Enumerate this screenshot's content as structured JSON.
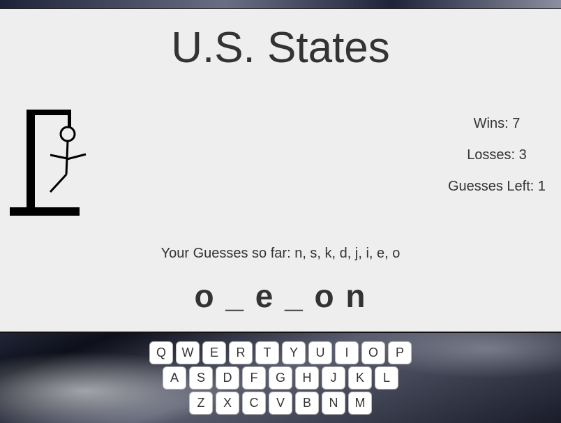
{
  "game": {
    "title": "U.S. States",
    "stats": {
      "wins": "Wins: 7",
      "losses": "Losses: 3",
      "guesses_left": "Guesses Left: 1"
    },
    "guesses_text": "Your Guesses so far: n, s, k, d, j, i, e, o",
    "word_display": "o _ e _ o n"
  },
  "keyboard": {
    "rows": [
      [
        "Q",
        "W",
        "E",
        "R",
        "T",
        "Y",
        "U",
        "I",
        "O",
        "P"
      ],
      [
        "A",
        "S",
        "D",
        "F",
        "G",
        "H",
        "J",
        "K",
        "L"
      ],
      [
        "Z",
        "X",
        "C",
        "V",
        "B",
        "N",
        "M"
      ]
    ]
  },
  "colors": {
    "panel_bg": "#eeeeee",
    "text": "#333333",
    "key_bg": "#ffffff"
  }
}
